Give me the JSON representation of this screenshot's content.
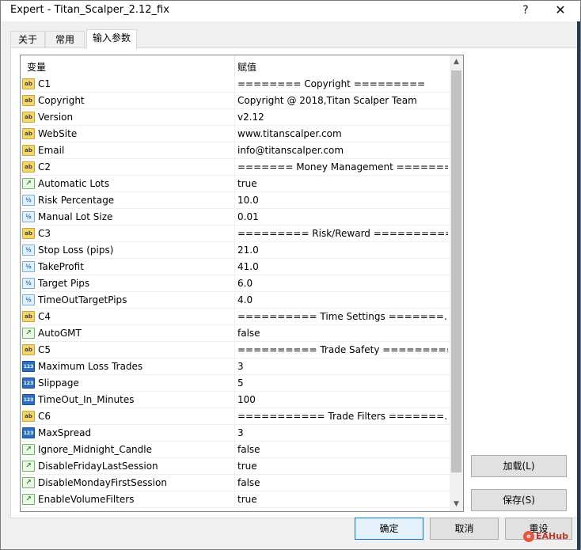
{
  "window": {
    "title": "Expert - Titan_Scalper_2.12_fix",
    "help": "?",
    "close": "✕"
  },
  "tabs": [
    {
      "label": "关于"
    },
    {
      "label": "常用"
    },
    {
      "label": "输入参数"
    }
  ],
  "grid": {
    "header": {
      "variable": "变量",
      "value": "赋值"
    },
    "rows": [
      {
        "icon": "ab",
        "name": "C1",
        "value": "======== Copyright ========="
      },
      {
        "icon": "ab",
        "name": "Copyright",
        "value": "Copyright @ 2018,Titan Scalper Team"
      },
      {
        "icon": "ab",
        "name": "Version",
        "value": "v2.12"
      },
      {
        "icon": "ab",
        "name": "WebSite",
        "value": "www.titanscalper.com"
      },
      {
        "icon": "ab",
        "name": "Email",
        "value": "info@titanscalper.com"
      },
      {
        "icon": "ab",
        "name": "C2",
        "value": "======= Money Management ======="
      },
      {
        "icon": "bool",
        "name": "Automatic Lots",
        "value": "true"
      },
      {
        "icon": "num",
        "name": "Risk Percentage",
        "value": "10.0"
      },
      {
        "icon": "num",
        "name": "Manual Lot Size",
        "value": "0.01"
      },
      {
        "icon": "ab",
        "name": "C3",
        "value": "========= Risk/Reward ==========="
      },
      {
        "icon": "num",
        "name": "Stop Loss (pips)",
        "value": "21.0"
      },
      {
        "icon": "num",
        "name": "TakeProfit",
        "value": "41.0"
      },
      {
        "icon": "num",
        "name": "Target Pips",
        "value": "6.0"
      },
      {
        "icon": "num",
        "name": "TimeOutTargetPips",
        "value": "4.0"
      },
      {
        "icon": "ab",
        "name": "C4",
        "value": "========== Time Settings =======..."
      },
      {
        "icon": "bool",
        "name": "AutoGMT",
        "value": "false"
      },
      {
        "icon": "ab",
        "name": "C5",
        "value": "========== Trade Safety =========="
      },
      {
        "icon": "int",
        "name": "Maximum Loss Trades",
        "value": "3"
      },
      {
        "icon": "int",
        "name": "Slippage",
        "value": "5"
      },
      {
        "icon": "int",
        "name": "TimeOut_In_Minutes",
        "value": "100"
      },
      {
        "icon": "ab",
        "name": "C6",
        "value": "=========== Trade Filters =======..."
      },
      {
        "icon": "int",
        "name": "MaxSpread",
        "value": "3"
      },
      {
        "icon": "bool",
        "name": "Ignore_Midnight_Candle",
        "value": "false"
      },
      {
        "icon": "bool",
        "name": "DisableFridayLastSession",
        "value": "true"
      },
      {
        "icon": "bool",
        "name": "DisableMondayFirstSession",
        "value": "false"
      },
      {
        "icon": "bool",
        "name": "EnableVolumeFilters",
        "value": "true"
      }
    ]
  },
  "icons": {
    "ab": "ab",
    "num": "½",
    "int": "123",
    "bool": "↗"
  },
  "buttons": {
    "load": "加载(L)",
    "save": "保存(S)",
    "ok": "确定",
    "cancel": "取消",
    "reset": "重设"
  },
  "watermark": {
    "text": "EAHub"
  },
  "colors": {
    "accent": "#0078d7",
    "watermark": "#c0392b"
  }
}
